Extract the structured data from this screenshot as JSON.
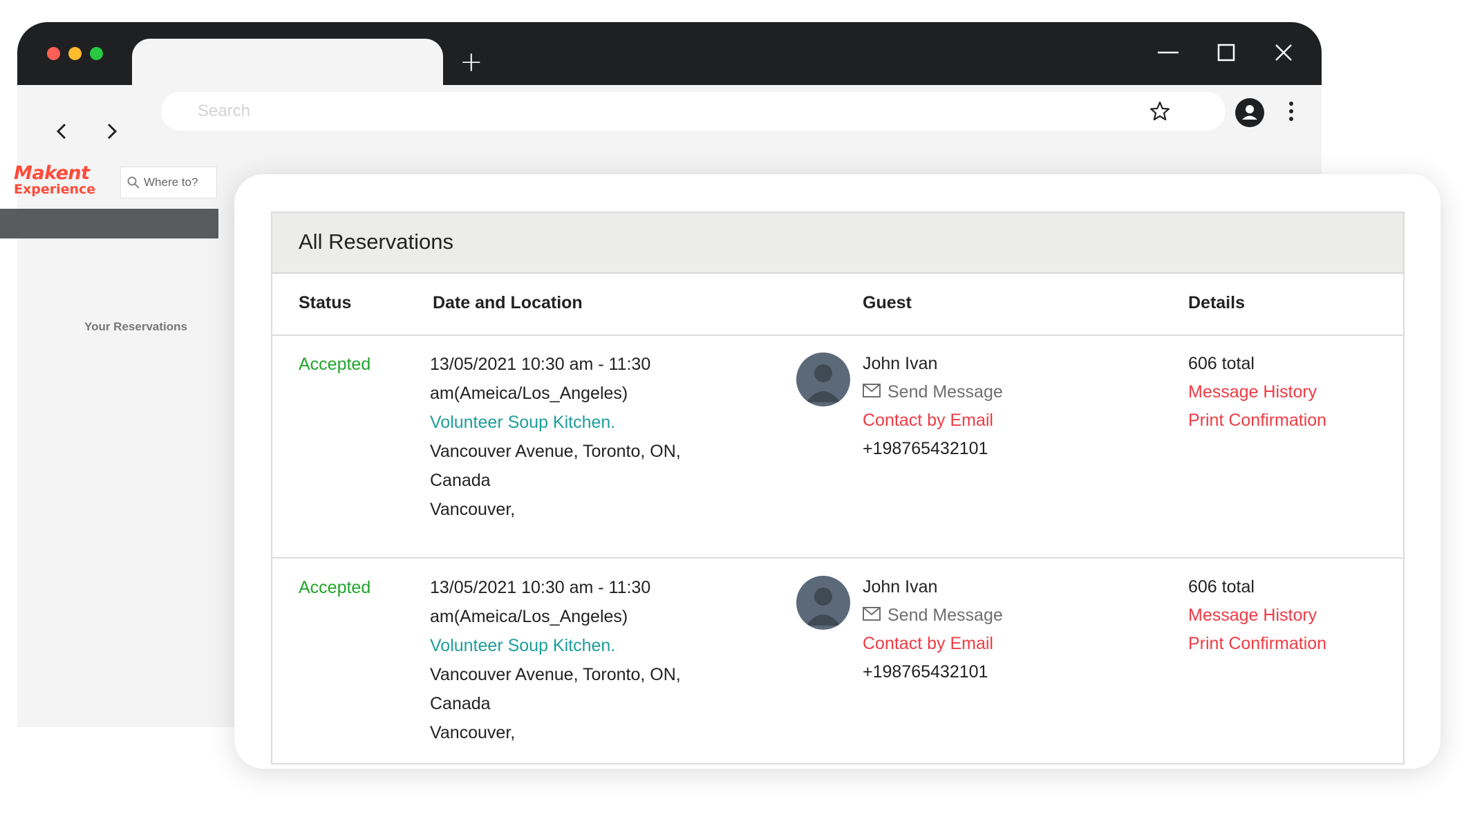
{
  "browser": {
    "address_placeholder": "Search",
    "new_tab_label": "+"
  },
  "site": {
    "logo_line1": "Makent",
    "logo_line2": "Experience",
    "search_placeholder": "Where to?",
    "sidebar_label": "Your Reservations"
  },
  "reservations": {
    "title": "All Reservations",
    "columns": [
      "Status",
      "Date and Location",
      "Guest",
      "Details"
    ],
    "rows": [
      {
        "status": "Accepted",
        "date_line1": "13/05/2021 10:30 am - 11:30",
        "date_line2": "am(Ameica/Los_Angeles)",
        "location_link": "Volunteer Soup Kitchen.",
        "address_line1": "Vancouver Avenue, Toronto, ON,",
        "address_line2": "Canada",
        "address_line3": "Vancouver,",
        "guest_name": "John Ivan",
        "send_message": "Send Message",
        "contact_email": "Contact by Email",
        "phone": "+198765432101",
        "total": "606 total",
        "message_history": "Message History",
        "print_confirmation": "Print Confirmation"
      },
      {
        "status": "Accepted",
        "date_line1": "13/05/2021 10:30 am - 11:30",
        "date_line2": "am(Ameica/Los_Angeles)",
        "location_link": "Volunteer Soup Kitchen.",
        "address_line1": "Vancouver Avenue, Toronto, ON,",
        "address_line2": "Canada",
        "address_line3": "Vancouver,",
        "guest_name": "John Ivan",
        "send_message": "Send Message",
        "contact_email": "Contact by Email",
        "phone": "+198765432101",
        "total": "606 total",
        "message_history": "Message History",
        "print_confirmation": "Print Confirmation"
      }
    ]
  },
  "icons": {
    "nav_back": "chevron-left-icon",
    "nav_forward": "chevron-right-icon",
    "bookmark": "star-icon",
    "profile": "user-avatar-icon",
    "menu": "kebab-menu-icon",
    "minimize": "minimize-icon",
    "maximize": "maximize-icon",
    "close": "close-icon",
    "mail": "mail-icon",
    "search": "search-icon"
  },
  "colors": {
    "status_accepted": "#1fa52b",
    "link_teal": "#1e9e9b",
    "link_red": "#ef3b44",
    "brand": "#ff4b3a",
    "titlebar": "#1f2022"
  }
}
